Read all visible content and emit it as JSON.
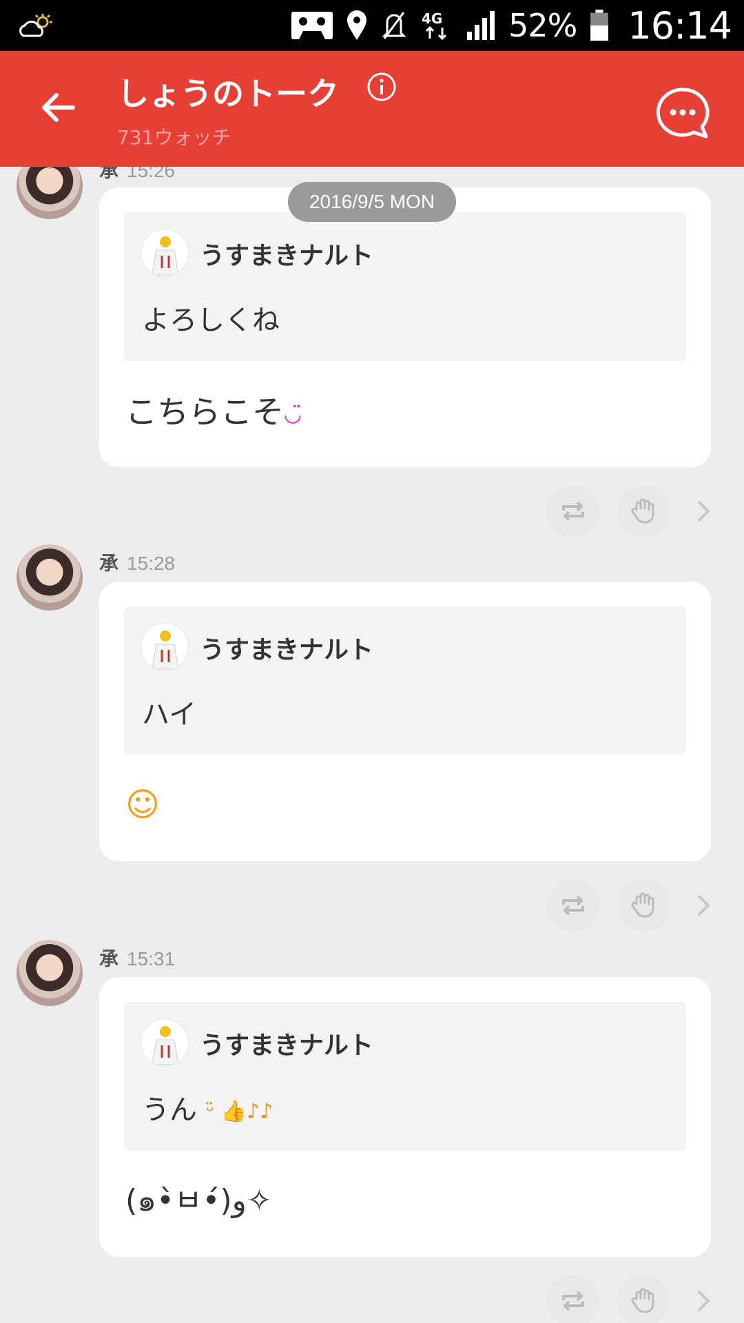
{
  "status_bar": {
    "battery": "52%",
    "time": "16:14",
    "icons": [
      "weather-cloudy-sun-icon",
      "cassette-icon",
      "location-pin-icon",
      "mute-icon",
      "network-4g-icon",
      "signal-icon",
      "battery-icon"
    ]
  },
  "header": {
    "title": "しょうのトーク",
    "subtitle": "731ウォッチ",
    "back_icon": "back-arrow-icon",
    "info_icon": "info-icon",
    "menu_icon": "chat-bubble-menu-icon",
    "color": "#e53f36"
  },
  "date_separator": "2016/9/5 MON",
  "posts": [
    {
      "author": "承",
      "time": "15:26",
      "quote": {
        "author": "うすまきナルト",
        "text": "よろしくね"
      },
      "reply": "こちらこそ",
      "reply_emoji": "◡̈"
    },
    {
      "author": "承",
      "time": "15:28",
      "quote": {
        "author": "うすまきナルト",
        "text": "ハイ"
      },
      "reply": "☺",
      "reply_emoji": ""
    },
    {
      "author": "承",
      "time": "15:31",
      "quote": {
        "author": "うすまきナルト",
        "text": "うん",
        "emoji": "ᵕ̈ 👍♪♪"
      },
      "reply": "(๑•̀ㅂ•́)و✧",
      "reply_emoji": ""
    }
  ],
  "actions": [
    "repost-icon",
    "like-hand-icon",
    "chevron-right-icon"
  ]
}
